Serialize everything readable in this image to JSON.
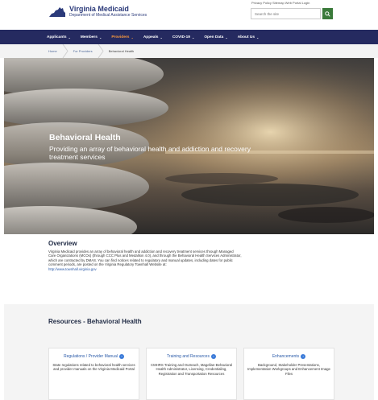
{
  "header": {
    "logo_title": "Virginia Medicaid",
    "logo_sub": "Department of Medical Assistance Services",
    "utility_text": "Privacy Policy   Sitemap   Web Portal Login",
    "search_placeholder": "Search the site"
  },
  "nav": {
    "items": [
      {
        "label": "Applicants"
      },
      {
        "label": "Members"
      },
      {
        "label": "Providers"
      },
      {
        "label": "Appeals"
      },
      {
        "label": "COVID-19"
      },
      {
        "label": "Open Data"
      },
      {
        "label": "About Us"
      }
    ],
    "active_index": 2
  },
  "breadcrumb": {
    "items": [
      "Home",
      "For Providers",
      "Behavioral Health"
    ]
  },
  "hero": {
    "title": "Behavioral Health",
    "subtitle": "Providing an array of behavioral health and addiction and recovery treatment services"
  },
  "overview": {
    "title": "Overview",
    "body": "Virginia Medicaid provides an array of behavioral health and addiction and recovery treatment services through Managed Care Organizations (MCOs) (through CCC Plus and Medallion 4.0), and through the Behavioral Health Services Administrator, which are contracted by DMAS. You can find notices related to regulatory and manual updates, including dates for public comment periods, are posted on the Virginia Regulatory Townhall Website at:",
    "link": "http://www.townhall.virginia.gov"
  },
  "resources": {
    "title": "Resources - Behavioral Health",
    "cards": [
      {
        "title": "Regulations / Provider Manual",
        "desc": "State regulations related to behavioral health services and provider manuals on the Virginia Medicaid Portal"
      },
      {
        "title": "Training and Resources",
        "desc": "CMHRS Training and Outreach, Magellan-Behavioral Health Administrator, Licensing, Credentialing, Registration and Transportation Resources"
      },
      {
        "title": "Enhancements",
        "desc": "Background, Stakeholder Presentations, Implementation Workgroups and Enhancement Image Files"
      }
    ]
  },
  "colors": {
    "nav_bg": "#252a60",
    "nav_active": "#ff9b3c",
    "link": "#2a5aa8",
    "search_button": "#3a7a3a"
  },
  "icons": [
    "virginia-state-icon",
    "search-icon",
    "chevron-down-icon",
    "arrow-right-icon"
  ]
}
